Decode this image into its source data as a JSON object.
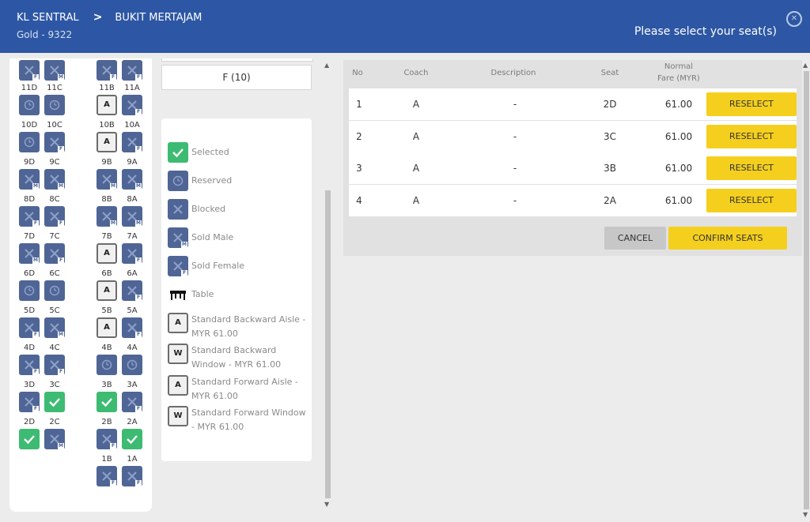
{
  "header": {
    "origin": "KL SENTRAL",
    "destination": "BUKIT MERTAJAM",
    "train": "Gold - 9322",
    "prompt": "Please select your seat(s)"
  },
  "seatmap": {
    "rows": [
      {
        "labels": [
          "11D",
          "11C",
          "11B",
          "11A"
        ],
        "seats": [
          "reserved",
          "reserved",
          "aisle-A",
          "sold-F"
        ]
      },
      {
        "labels": [
          "10D",
          "10C",
          "10B",
          "10A"
        ],
        "seats": [
          "reserved",
          "sold-F",
          "aisle-A",
          "sold-F"
        ]
      },
      {
        "labels": [
          "9D",
          "9C",
          "9B",
          "9A"
        ],
        "seats": [
          "sold-M",
          "sold-M",
          "sold-M",
          "sold-M"
        ]
      },
      {
        "labels": [
          "8D",
          "8C",
          "8B",
          "8A"
        ],
        "seats": [
          "sold-F",
          "sold-F",
          "sold-M",
          "sold-M"
        ]
      },
      {
        "labels": [
          "7D",
          "7C",
          "7B",
          "7A"
        ],
        "seats": [
          "sold-M",
          "sold-F",
          "aisle-A",
          "sold-F"
        ]
      },
      {
        "labels": [
          "6D",
          "6C",
          "6B",
          "6A"
        ],
        "seats": [
          "reserved",
          "reserved",
          "aisle-A",
          "sold-F"
        ]
      },
      {
        "labels": [
          "5D",
          "5C",
          "5B",
          "5A"
        ],
        "seats": [
          "sold-F",
          "sold-M",
          "aisle-A",
          "sold-F"
        ]
      },
      {
        "labels": [
          "4D",
          "4C",
          "4B",
          "4A"
        ],
        "seats": [
          "sold-F",
          "sold-F",
          "reserved",
          "reserved"
        ]
      },
      {
        "labels": [
          "3D",
          "3C",
          "3B",
          "3A"
        ],
        "seats": [
          "sold-F",
          "selected",
          "selected",
          "sold-F"
        ]
      },
      {
        "labels": [
          "2D",
          "2C",
          "2B",
          "2A"
        ],
        "seats": [
          "selected",
          "sold-M",
          "sold-F",
          "selected"
        ]
      },
      {
        "labels": [
          "",
          "",
          "1B",
          "1A"
        ],
        "seats": [
          "",
          "",
          "sold-F",
          "sold-F"
        ]
      }
    ],
    "top_partial": [
      "sold-F",
      "sold-M",
      "sold-F",
      "sold-F"
    ]
  },
  "coach": {
    "label": "F (10)"
  },
  "legend": {
    "items": [
      {
        "type": "selected",
        "label": "Selected"
      },
      {
        "type": "reserved",
        "label": "Reserved"
      },
      {
        "type": "blocked",
        "label": "Blocked"
      },
      {
        "type": "sold-M",
        "label": "Sold Male"
      },
      {
        "type": "sold-F",
        "label": "Sold Female"
      },
      {
        "type": "table",
        "label": "Table"
      },
      {
        "type": "A",
        "label": "Standard Backward Aisle - MYR 61.00"
      },
      {
        "type": "W",
        "label": "Standard Backward Window - MYR 61.00"
      },
      {
        "type": "A",
        "label": "Standard Forward Aisle - MYR 61.00"
      },
      {
        "type": "W",
        "label": "Standard Forward Window - MYR 61.00"
      }
    ]
  },
  "table": {
    "headers": {
      "no": "No",
      "coach": "Coach",
      "description": "Description",
      "seat": "Seat",
      "fare_line1": "Normal",
      "fare_line2": "Fare (MYR)"
    },
    "rows": [
      {
        "no": "1",
        "coach": "A",
        "description": "-",
        "seat": "2D",
        "fare": "61.00",
        "action": "RESELECT"
      },
      {
        "no": "2",
        "coach": "A",
        "description": "-",
        "seat": "3C",
        "fare": "61.00",
        "action": "RESELECT"
      },
      {
        "no": "3",
        "coach": "A",
        "description": "-",
        "seat": "3B",
        "fare": "61.00",
        "action": "RESELECT"
      },
      {
        "no": "4",
        "coach": "A",
        "description": "-",
        "seat": "2A",
        "fare": "61.00",
        "action": "RESELECT"
      }
    ],
    "cancel_label": "CANCEL",
    "confirm_label": "CONFIRM SEATS"
  },
  "colors": {
    "header": "#2d57a4",
    "sold": "#4f6595",
    "selected": "#3dbb72",
    "button": "#f5cf1e"
  }
}
